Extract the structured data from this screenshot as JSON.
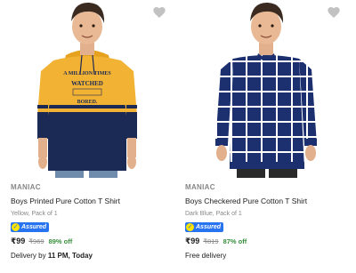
{
  "products": [
    {
      "brand": "MANIAC",
      "title": "Boys Printed Pure Cotton T Shirt",
      "variant": "Yellow, Pack of 1",
      "assured_label": "Assured",
      "price": "₹99",
      "mrp": "₹969",
      "discount": "89% off",
      "delivery_prefix": "Delivery by",
      "delivery_bold": "11 PM, Today",
      "image": {
        "name": "boy-in-yellow-navy-hoodie",
        "print_text": [
          "A MILLION TIMES",
          "WATCHED",
          "BORED."
        ]
      },
      "colors": {
        "main": "#f2b233",
        "secondary": "#1b2a55"
      }
    },
    {
      "brand": "MANIAC",
      "title": "Boys Checkered Pure Cotton T Shirt",
      "variant": "Dark Blue, Pack of 1",
      "assured_label": "Assured",
      "price": "₹99",
      "mrp": "₹819",
      "discount": "87% off",
      "delivery_prefix": "Free delivery",
      "delivery_bold": "",
      "image": {
        "name": "boy-in-navy-checkered-sweatshirt"
      },
      "colors": {
        "main": "#1c2f6e",
        "secondary": "#ffffff"
      }
    }
  ],
  "ui": {
    "wishlist_icon": "heart-icon",
    "assured_icon": "check-icon",
    "accent": "#2874f0",
    "discount_color": "#388e3c"
  }
}
